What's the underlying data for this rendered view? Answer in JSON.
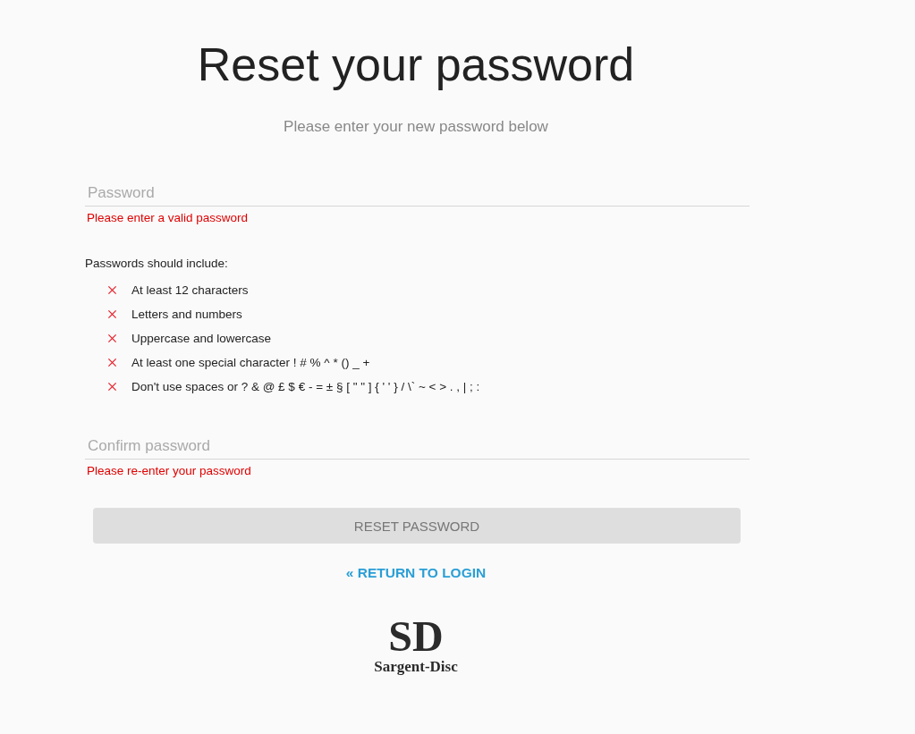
{
  "title": "Reset your password",
  "subtitle": "Please enter your new password below",
  "password": {
    "placeholder": "Password",
    "error": "Please enter a valid password"
  },
  "requirements_heading": "Passwords should include:",
  "requirements": [
    {
      "text": "At least 12 characters",
      "met": false
    },
    {
      "text": "Letters and numbers",
      "met": false
    },
    {
      "text": "Uppercase and lowercase",
      "met": false
    },
    {
      "text": "At least one special character ! # % ^ * () _ +",
      "met": false
    },
    {
      "text": "Don't use spaces or ? & @ £ $ € - = ± § [ \" \" ] { ' ' } / \\` ~ < > . , | ; :",
      "met": false
    }
  ],
  "confirm": {
    "placeholder": "Confirm password",
    "error": "Please re-enter your password"
  },
  "reset_button": {
    "label": "RESET PASSWORD",
    "disabled": true
  },
  "return_link": "« RETURN TO LOGIN",
  "logo": {
    "mark": "SD",
    "name": "Sargent-Disc"
  }
}
